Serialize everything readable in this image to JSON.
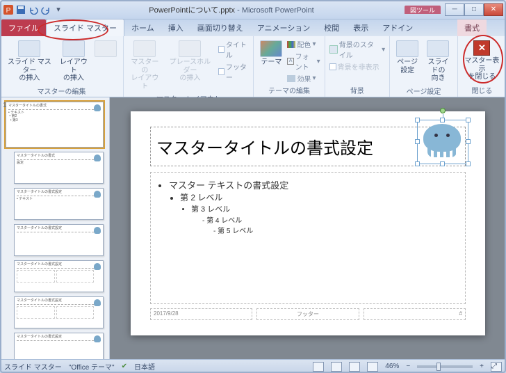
{
  "title": {
    "file": "PowerPointについて.pptx",
    "app": "Microsoft PowerPoint"
  },
  "toolsTab": {
    "group": "図ツール",
    "tab": "書式"
  },
  "tabs": {
    "file": "ファイル",
    "slideMaster": "スライド マスター",
    "home": "ホーム",
    "insert": "挿入",
    "transitions": "画面切り替え",
    "animations": "アニメーション",
    "review": "校閲",
    "view": "表示",
    "addins": "アドイン"
  },
  "ribbon": {
    "masterEdit": {
      "insertSlideMaster": "スライド マスター\nの挿入",
      "insertLayout": "レイアウト\nの挿入",
      "group": "マスターの編集"
    },
    "masterLayout": {
      "masterLayout": "マスターの\nレイアウト",
      "insertPlaceholder": "プレースホルダー\nの挿入",
      "title": "タイトル",
      "footer": "フッター",
      "group": "マスター レイアウト"
    },
    "themeEdit": {
      "themes": "テーマ",
      "colors": "配色",
      "fonts": "フォント",
      "effects": "効果",
      "group": "テーマの編集"
    },
    "background": {
      "bgStyle": "背景のスタイル",
      "hideBg": "背景を非表示",
      "group": "背景"
    },
    "pageSetup": {
      "pageSetup": "ページ\n設定",
      "orient": "スライドの\n向き",
      "group": "ページ設定"
    },
    "close": {
      "closeMaster": "マスター表示\nを閉じる",
      "group": "閉じる"
    }
  },
  "slide": {
    "title": "マスタータイトルの書式設定",
    "body1": "マスター テキストの書式設定",
    "lvl2": "第 2 レベル",
    "lvl3": "第 3 レベル",
    "lvl4": "第 4 レベル",
    "lvl5": "第 5 レベル",
    "date": "2017/9/28",
    "footer": "フッター",
    "num": "#"
  },
  "status": {
    "mode": "スライド マスター",
    "theme": "\"Office テーマ\"",
    "lang": "日本語",
    "zoom": "46%"
  }
}
